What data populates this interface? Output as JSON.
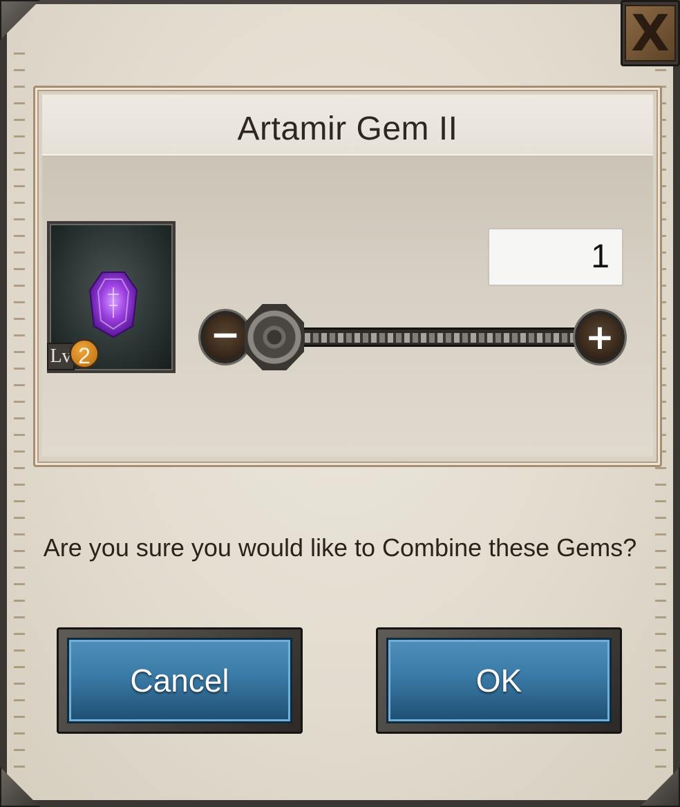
{
  "dialog": {
    "title": "Artamir Gem II",
    "close_label": "X",
    "gem": {
      "icon": "purple-gem-icon",
      "level_prefix": "Lv",
      "level": "2"
    },
    "quantity": "1",
    "slider": {
      "minus_label": "−",
      "plus_label": "+",
      "value_fraction": 0
    },
    "message": "Are you sure you would like to Combine these Gems?",
    "buttons": {
      "cancel": "Cancel",
      "ok": "OK"
    },
    "colors": {
      "button_blue": "#3a7aa6",
      "gem_purple": "#9b3fe0",
      "level_badge": "#d88a1e"
    }
  }
}
